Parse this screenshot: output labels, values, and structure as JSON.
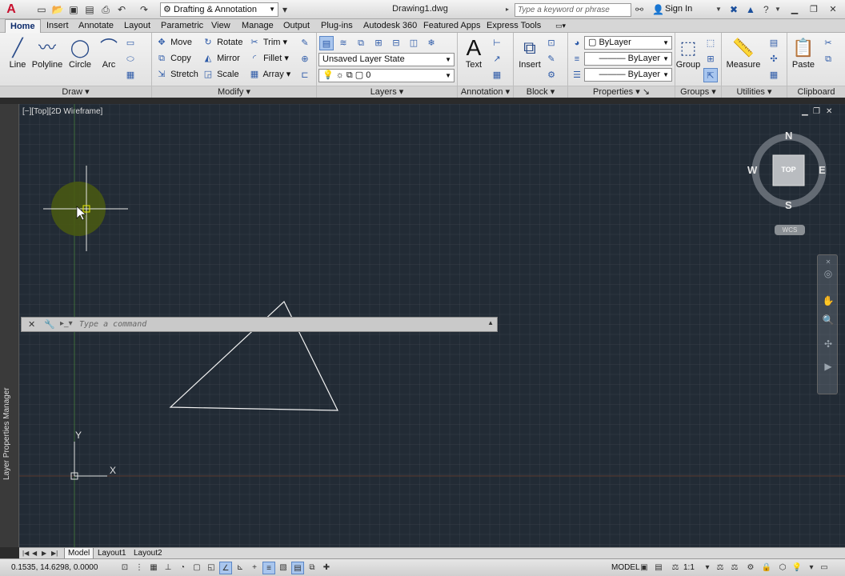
{
  "titlebar": {
    "workspace": "Drafting & Annotation",
    "document_title": "Drawing1.dwg",
    "search_placeholder": "Type a keyword or phrase",
    "signin": "Sign In"
  },
  "tabs": [
    "Home",
    "Insert",
    "Annotate",
    "Layout",
    "Parametric",
    "View",
    "Manage",
    "Output",
    "Plug-ins",
    "Autodesk 360",
    "Featured Apps",
    "Express Tools"
  ],
  "ribbon": {
    "draw": {
      "title": "Draw",
      "line": "Line",
      "polyline": "Polyline",
      "circle": "Circle",
      "arc": "Arc"
    },
    "modify": {
      "title": "Modify",
      "move": "Move",
      "rotate": "Rotate",
      "trim": "Trim",
      "copy": "Copy",
      "mirror": "Mirror",
      "fillet": "Fillet",
      "stretch": "Stretch",
      "scale": "Scale",
      "array": "Array"
    },
    "layers": {
      "title": "Layers",
      "layer_state": "Unsaved Layer State",
      "current_layer": "0"
    },
    "annotation": {
      "title": "Annotation",
      "text": "Text"
    },
    "block": {
      "title": "Block",
      "insert": "Insert"
    },
    "properties": {
      "title": "Properties",
      "color": "ByLayer",
      "linetype": "ByLayer",
      "lineweight": "ByLayer"
    },
    "groups": {
      "title": "Groups",
      "group": "Group"
    },
    "utilities": {
      "title": "Utilities",
      "measure": "Measure"
    },
    "clipboard": {
      "title": "Clipboard",
      "paste": "Paste"
    }
  },
  "viewport": {
    "label": "[−][Top][2D Wireframe]"
  },
  "leftbar": {
    "label": "Layer Properties Manager"
  },
  "viewcube": {
    "north": "N",
    "south": "S",
    "east": "E",
    "west": "W",
    "face": "TOP",
    "wcs": "WCS"
  },
  "ucs": {
    "x": "X",
    "y": "Y"
  },
  "command": {
    "placeholder": "Type a command"
  },
  "layout_tabs": [
    "Model",
    "Layout1",
    "Layout2"
  ],
  "statusbar": {
    "coords": "0.1535, 14.6298, 0.0000",
    "model": "MODEL",
    "scale": "1:1"
  },
  "colors": {
    "canvas": "#222b35",
    "accent": "#c8102e",
    "selection": "#a9c6ee"
  }
}
